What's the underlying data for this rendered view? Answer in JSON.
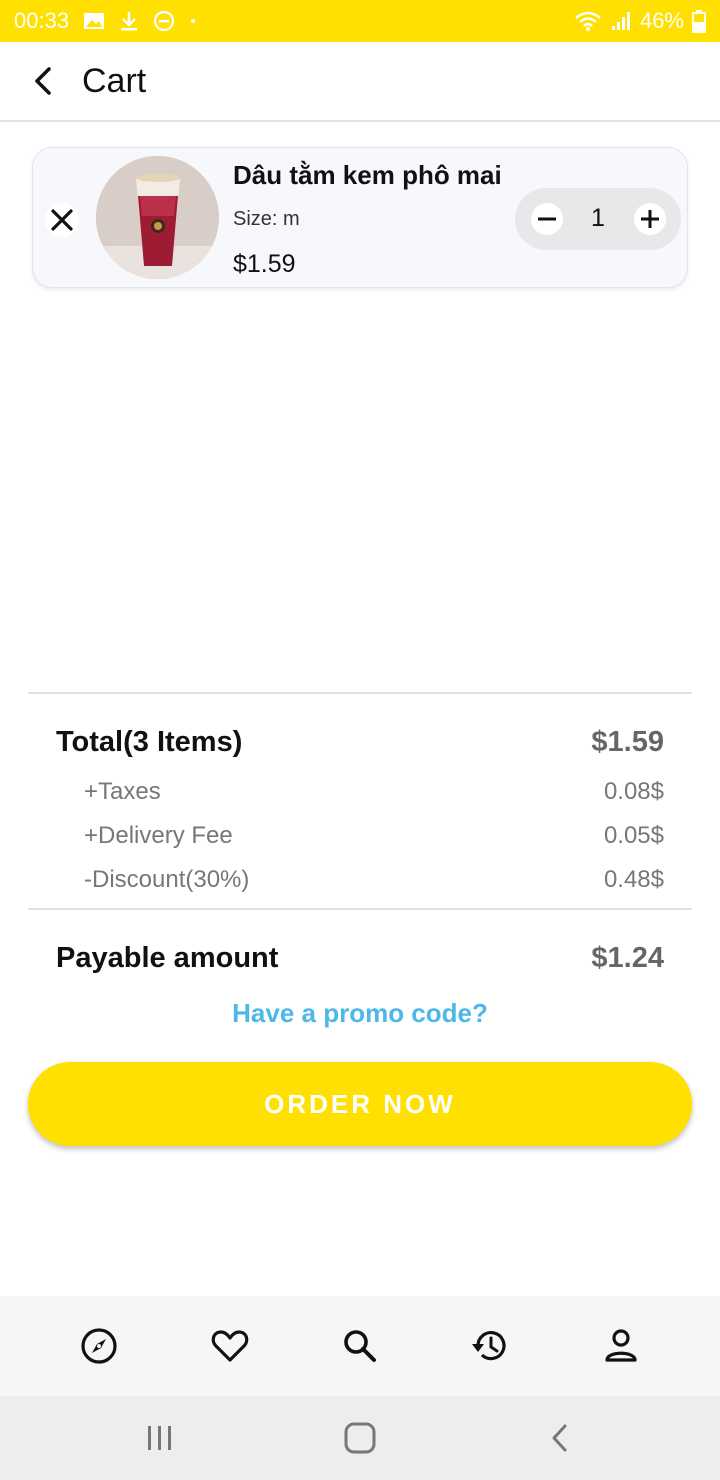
{
  "status_bar": {
    "time": "00:33",
    "battery": "46%",
    "bg_color": "#FFE000"
  },
  "header": {
    "title": "Cart"
  },
  "cart_items": [
    {
      "name": "Dâu tằm kem phô mai",
      "size": "Size: m",
      "price": "$1.59",
      "quantity": "1"
    }
  ],
  "summary": {
    "total_label": "Total(3 Items)",
    "total_value": "$1.59",
    "taxes_label": "+Taxes",
    "taxes_value": "0.08$",
    "delivery_label": "+Delivery Fee",
    "delivery_value": "0.05$",
    "discount_label": "-Discount(30%)",
    "discount_value": "0.48$",
    "payable_label": "Payable amount",
    "payable_value": "$1.24"
  },
  "promo": {
    "label": "Have a promo code?",
    "color": "#4DB8E8"
  },
  "order_button": {
    "label": "ORDER NOW",
    "color": "#FFE000"
  },
  "bottom_nav": {
    "items": [
      "compass-icon",
      "heart-icon",
      "search-icon",
      "history-icon",
      "person-icon"
    ]
  },
  "system_nav": {
    "items": [
      "recents-icon",
      "home-icon",
      "back-icon"
    ]
  }
}
